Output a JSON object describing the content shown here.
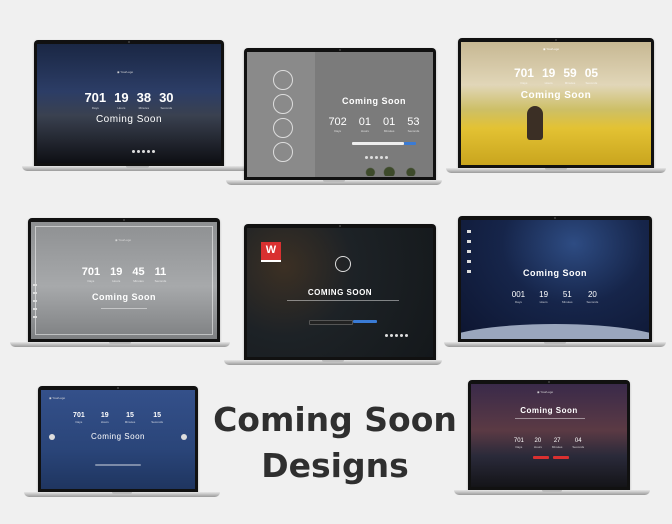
{
  "heading": {
    "line1": "Coming Soon",
    "line2": "Designs"
  },
  "laptops": {
    "l1": {
      "title": "Coming Soon",
      "nums": [
        "701",
        "19",
        "38",
        "30"
      ],
      "labels": [
        "Days",
        "Hours",
        "Minutes",
        "Seconds"
      ]
    },
    "l2": {
      "title": "Coming Soon",
      "nums": [
        "702",
        "01",
        "01",
        "53"
      ],
      "labels": [
        "Days",
        "Hours",
        "Minutes",
        "Seconds"
      ],
      "button": "Submit"
    },
    "l3": {
      "title": "Coming Soon",
      "nums": [
        "701",
        "19",
        "59",
        "05"
      ],
      "labels": [
        "Days",
        "Hours",
        "Minutes",
        "Seconds"
      ]
    },
    "l4": {
      "title": "Coming Soon",
      "nums": [
        "701",
        "19",
        "45",
        "11"
      ],
      "labels": [
        "Days",
        "Hours",
        "Minutes",
        "Seconds"
      ]
    },
    "l5": {
      "title": "COMING SOON",
      "badge": "W",
      "button": "Subscribe"
    },
    "l6": {
      "title": "Coming Soon",
      "nums": [
        "001",
        "19",
        "51",
        "20"
      ],
      "labels": [
        "Days",
        "Hours",
        "Minutes",
        "Seconds"
      ]
    },
    "l7": {
      "title": "Coming Soon",
      "nums": [
        "701",
        "19",
        "15",
        "15"
      ],
      "labels": [
        "Days",
        "Hours",
        "Minutes",
        "Seconds"
      ]
    },
    "l8": {
      "title": "Coming Soon",
      "nums": [
        "701",
        "20",
        "27",
        "04"
      ],
      "labels": [
        "Days",
        "Hours",
        "Minutes",
        "Seconds"
      ]
    }
  },
  "colors": {
    "page_bg": "#f0f0f0",
    "heading": "#2f2f2f",
    "accent_blue": "#3a7bd5",
    "accent_red": "#d93030"
  }
}
